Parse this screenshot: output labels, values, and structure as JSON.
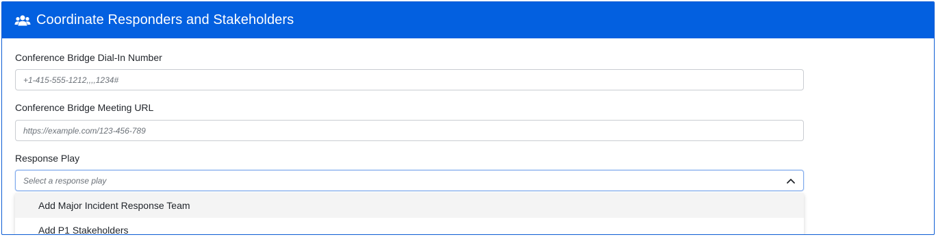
{
  "panel": {
    "title": "Coordinate Responders and Stakeholders",
    "icon": "users-icon",
    "header_color": "#0360e0"
  },
  "fields": {
    "dial_in": {
      "label": "Conference Bridge Dial-In Number",
      "placeholder": "+1-415-555-1212,,,,1234#",
      "value": ""
    },
    "meeting_url": {
      "label": "Conference Bridge Meeting URL",
      "placeholder": "https://example.com/123-456-789",
      "value": ""
    },
    "response_play": {
      "label": "Response Play",
      "placeholder": "Select a response play",
      "expanded_icon": "chevron-up-icon",
      "options": [
        "Add Major Incident Response Team",
        "Add P1 Stakeholders"
      ]
    }
  }
}
